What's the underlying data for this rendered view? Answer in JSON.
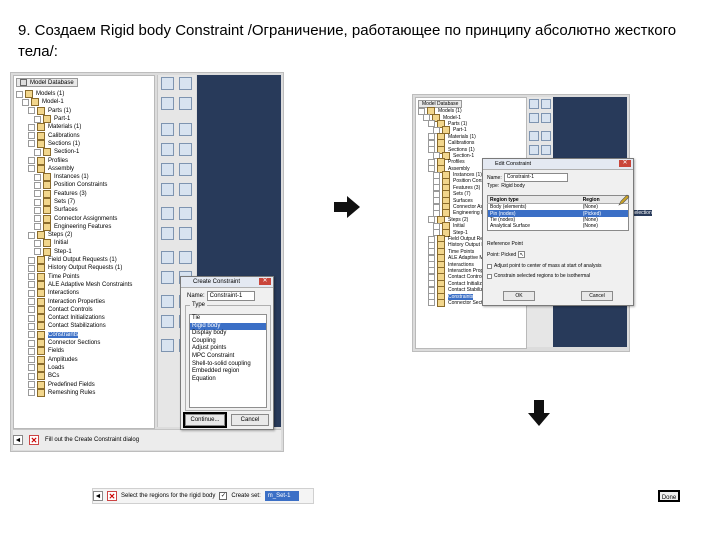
{
  "heading": "9. Создаем Rigid body Constraint /Ограничение, работающее по принципу абсолютно жесткого тела/:",
  "screenshot1": {
    "tree_tab": "Model Database",
    "tree_items": [
      {
        "label": "Models (1)",
        "indent": 0
      },
      {
        "label": "Model-1",
        "indent": 1
      },
      {
        "label": "Parts (1)",
        "indent": 2
      },
      {
        "label": "Part-1",
        "indent": 3
      },
      {
        "label": "Materials (1)",
        "indent": 2
      },
      {
        "label": "Calibrations",
        "indent": 2
      },
      {
        "label": "Sections (1)",
        "indent": 2
      },
      {
        "label": "Section-1",
        "indent": 3
      },
      {
        "label": "Profiles",
        "indent": 2
      },
      {
        "label": "Assembly",
        "indent": 2
      },
      {
        "label": "Instances (1)",
        "indent": 3
      },
      {
        "label": "Position Constraints",
        "indent": 3
      },
      {
        "label": "Features (3)",
        "indent": 3
      },
      {
        "label": "Sets (7)",
        "indent": 3
      },
      {
        "label": "Surfaces",
        "indent": 3
      },
      {
        "label": "Connector Assignments",
        "indent": 3
      },
      {
        "label": "Engineering Features",
        "indent": 3
      },
      {
        "label": "Steps (2)",
        "indent": 2
      },
      {
        "label": "Initial",
        "indent": 3
      },
      {
        "label": "Step-1",
        "indent": 3
      },
      {
        "label": "Field Output Requests (1)",
        "indent": 2
      },
      {
        "label": "History Output Requests (1)",
        "indent": 2
      },
      {
        "label": "Time Points",
        "indent": 2
      },
      {
        "label": "ALE Adaptive Mesh Constraints",
        "indent": 2
      },
      {
        "label": "Interactions",
        "indent": 2
      },
      {
        "label": "Interaction Properties",
        "indent": 2
      },
      {
        "label": "Contact Controls",
        "indent": 2
      },
      {
        "label": "Contact Initializations",
        "indent": 2
      },
      {
        "label": "Contact Stabilizations",
        "indent": 2
      },
      {
        "label": "Constraints",
        "indent": 2,
        "selected": true
      },
      {
        "label": "Connector Sections",
        "indent": 2
      },
      {
        "label": "Fields",
        "indent": 2
      },
      {
        "label": "Amplitudes",
        "indent": 2
      },
      {
        "label": "Loads",
        "indent": 2
      },
      {
        "label": "BCs",
        "indent": 2
      },
      {
        "label": "Predefined Fields",
        "indent": 2
      },
      {
        "label": "Remeshing Rules",
        "indent": 2
      }
    ],
    "dialog": {
      "title": "Create Constraint",
      "name_label": "Name:",
      "name_value": "Constraint-1",
      "type_label": "Type",
      "types": [
        "Tie",
        "Rigid body",
        "Display body",
        "Coupling",
        "Adjust points",
        "MPC Constraint",
        "Shell-to-solid coupling",
        "Embedded region",
        "Equation"
      ],
      "selected_type": "Rigid body",
      "continue_label": "Continue...",
      "cancel_label": "Cancel"
    },
    "prompt": "Fill out the Create Constraint dialog"
  },
  "screenshot2": {
    "tree_tab": "Model Database",
    "tree_items": [
      {
        "label": "Models (1)",
        "indent": 0
      },
      {
        "label": "Model-1",
        "indent": 1
      },
      {
        "label": "Parts (1)",
        "indent": 2
      },
      {
        "label": "Part-1",
        "indent": 3
      },
      {
        "label": "Materials (1)",
        "indent": 2
      },
      {
        "label": "Calibrations",
        "indent": 2
      },
      {
        "label": "Sections (1)",
        "indent": 2
      },
      {
        "label": "Section-1",
        "indent": 3
      },
      {
        "label": "Profiles",
        "indent": 2
      },
      {
        "label": "Assembly",
        "indent": 2
      },
      {
        "label": "Instances (1)",
        "indent": 3
      },
      {
        "label": "Position Constraints",
        "indent": 3
      },
      {
        "label": "Features (3)",
        "indent": 3
      },
      {
        "label": "Sets (7)",
        "indent": 3
      },
      {
        "label": "Surfaces",
        "indent": 3
      },
      {
        "label": "Connector Assignments",
        "indent": 3
      },
      {
        "label": "Engineering Features",
        "indent": 3
      },
      {
        "label": "Steps (2)",
        "indent": 2
      },
      {
        "label": "Initial",
        "indent": 3
      },
      {
        "label": "Step-1",
        "indent": 3
      },
      {
        "label": "Field Output Requests",
        "indent": 2
      },
      {
        "label": "History Output Requests",
        "indent": 2
      },
      {
        "label": "Time Points",
        "indent": 2
      },
      {
        "label": "ALE Adaptive Mesh",
        "indent": 2
      },
      {
        "label": "Interactions",
        "indent": 2
      },
      {
        "label": "Interaction Properties",
        "indent": 2
      },
      {
        "label": "Contact Controls",
        "indent": 2
      },
      {
        "label": "Contact Initializations",
        "indent": 2
      },
      {
        "label": "Contact Stabilizations",
        "indent": 2
      },
      {
        "label": "Constraints",
        "indent": 2,
        "selected": true
      },
      {
        "label": "Connector Sections",
        "indent": 2
      }
    ],
    "dialog": {
      "title": "Edit Constraint",
      "name_label": "Name:",
      "name_value": "Constraint-1",
      "type_label": "Type:",
      "type_value": "Rigid body",
      "columns": [
        "Region type",
        "Region"
      ],
      "rows": [
        {
          "type": "Body (elements)",
          "region": "(None)",
          "selected": false
        },
        {
          "type": "Pin (nodes)",
          "region": "(Picked)",
          "selected": true
        },
        {
          "type": "Tie (nodes)",
          "region": "(None)",
          "selected": false
        },
        {
          "type": "Analytical Surface",
          "region": "(None)",
          "selected": false
        }
      ],
      "ref_point_label": "Reference Point",
      "ref_point_value": "Point: Picked",
      "option1": "Adjust point to center of mass at start of analysis",
      "option2": "Constrain selected regions to be isothermal",
      "ok_label": "OK",
      "cancel_label": "Cancel"
    },
    "side_label": "selection"
  },
  "prompt_bar": {
    "text": "Select the regions for the rigid body",
    "create_set_label": "Create set:",
    "create_set_value": "m_Set-1",
    "done_label": "Done"
  }
}
